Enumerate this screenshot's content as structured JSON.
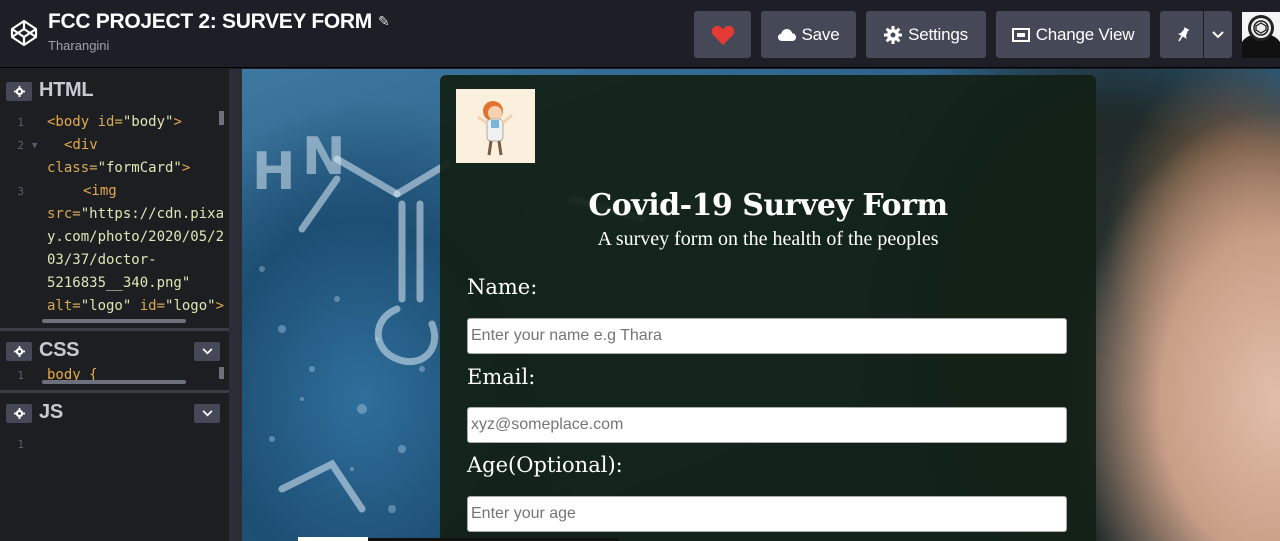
{
  "app": {
    "title": "FCC PROJECT 2: SURVEY FORM",
    "author": "Tharangini"
  },
  "toolbar": {
    "save_label": "Save",
    "settings_label": "Settings",
    "change_view_label": "Change View",
    "heart_color": "#e53935"
  },
  "editor": {
    "html": {
      "label": "HTML",
      "line_numbers": [
        "1",
        "2",
        "3"
      ],
      "code": {
        "line1_tag_open": "<body",
        "line1_attr": " id=",
        "line1_str": "\"body\"",
        "line1_close": ">",
        "line2a_tag": "<div",
        "line2b_attr": "class=",
        "line2b_str": "\"formCard\"",
        "line2b_close": ">",
        "line3a_tag": "<img",
        "line3b_attr": "src=",
        "line3b_str": "\"https://cdn.pixa",
        "line3c_str": "y.com/photo/2020/05/2",
        "line3d_str": "03/37/doctor-",
        "line3e_str": "5216835__340.png\"",
        "line3f_attr": "alt=",
        "line3f_str": "\"logo\"",
        "line3f_attr2": " id=",
        "line3f_str2": "\"logo\"",
        "line3f_close": ">"
      }
    },
    "css": {
      "label": "CSS",
      "line_number": "1",
      "code": "body {"
    },
    "js": {
      "label": "JS",
      "line_number": "1"
    }
  },
  "preview": {
    "form_title": "Covid-19 Survey Form",
    "form_subtitle": "A survey form on the health of the peoples",
    "fields": [
      {
        "label": "Name:",
        "placeholder": "Enter your name e.g Thara"
      },
      {
        "label": "Email:",
        "placeholder": "xyz@someplace.com"
      },
      {
        "label": "Age(Optional):",
        "placeholder": "Enter your age"
      }
    ]
  }
}
